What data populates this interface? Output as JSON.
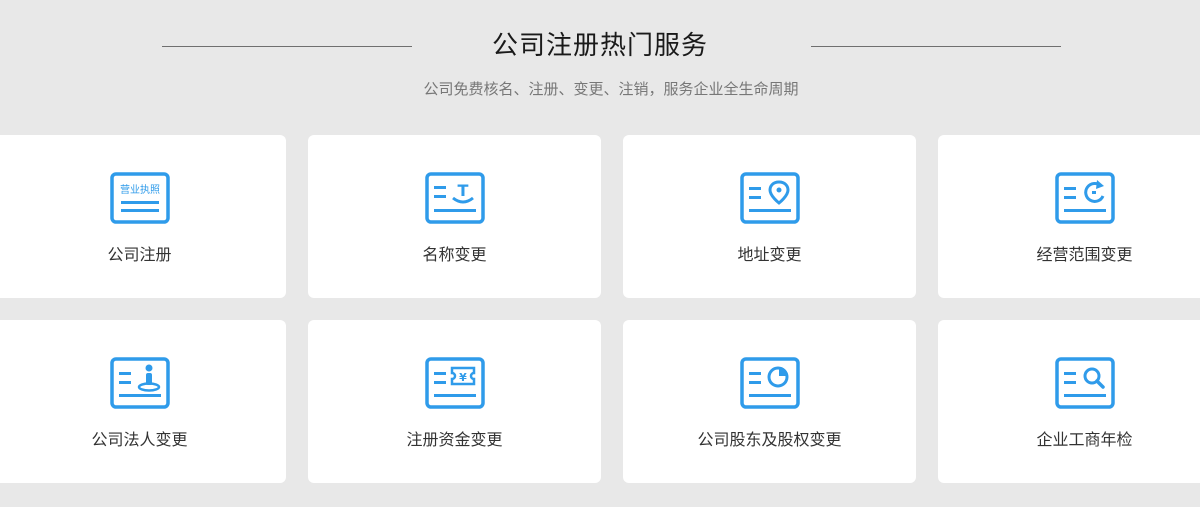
{
  "section": {
    "title": "公司注册热门服务",
    "subtitle": "公司免费核名、注册、变更、注销，服务企业全生命周期"
  },
  "accent_color": "#2f9bea",
  "services": [
    {
      "label": "公司注册",
      "icon": "business-license-icon",
      "icon_text": "营业执照"
    },
    {
      "label": "名称变更",
      "icon": "name-stamp-icon",
      "icon_text": "T"
    },
    {
      "label": "地址变更",
      "icon": "location-pin-icon"
    },
    {
      "label": "经营范围变更",
      "icon": "refresh-cycle-icon"
    },
    {
      "label": "公司法人变更",
      "icon": "legal-person-icon"
    },
    {
      "label": "注册资金变更",
      "icon": "capital-ticket-icon",
      "icon_text": "¥"
    },
    {
      "label": "公司股东及股权变更",
      "icon": "pie-chart-icon"
    },
    {
      "label": "企业工商年检",
      "icon": "magnifier-inspect-icon"
    }
  ]
}
